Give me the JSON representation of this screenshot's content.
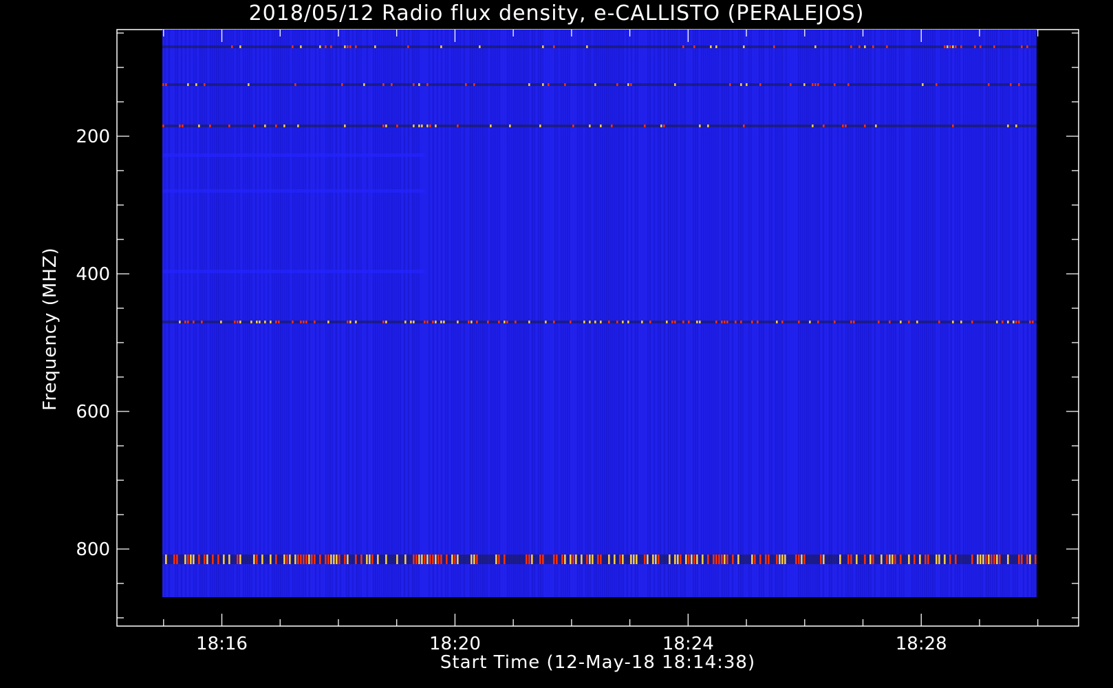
{
  "chart_data": {
    "type": "heatmap",
    "title": "2018/05/12  Radio flux density, e-CALLISTO (PERALEJOS)",
    "xlabel": "Start Time (12-May-18 18:14:38)",
    "ylabel": "Frequency (MHZ)",
    "x_tick_labels": [
      "18:16",
      "18:20",
      "18:24",
      "18:28"
    ],
    "x_ticks_minutes": [
      16,
      20,
      24,
      28
    ],
    "y_tick_labels": [
      "200",
      "400",
      "600",
      "800"
    ],
    "y_ticks": [
      200,
      400,
      600,
      800
    ],
    "xlim_minutes": [
      14.2,
      30.7
    ],
    "ylim": [
      45,
      912
    ],
    "data_xlim_minutes": [
      14.98,
      29.98
    ],
    "data_ylim": [
      45,
      870
    ],
    "y_inverted": true,
    "colormap": [
      "#0000c8",
      "#0a10f0",
      "#2424ff",
      "#1a1a50",
      "#ff3000",
      "#ffd040"
    ],
    "background_color": "#1f1fe8",
    "bright_emission_bands_mhz": [
      70,
      125,
      185,
      470,
      815
    ],
    "weak_band_mhz": [
      228,
      280,
      397
    ]
  }
}
